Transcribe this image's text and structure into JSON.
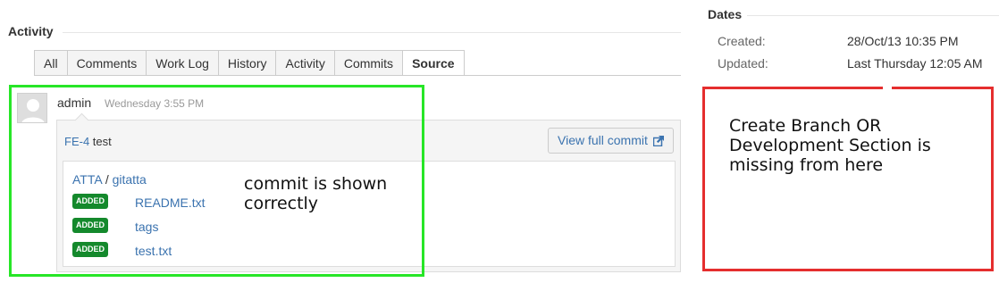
{
  "activity": {
    "title": "Activity",
    "tabs": [
      {
        "label": "All",
        "active": false
      },
      {
        "label": "Comments",
        "active": false
      },
      {
        "label": "Work Log",
        "active": false
      },
      {
        "label": "History",
        "active": false
      },
      {
        "label": "Activity",
        "active": false
      },
      {
        "label": "Commits",
        "active": false
      },
      {
        "label": "Source",
        "active": true
      }
    ]
  },
  "entry": {
    "author": "admin",
    "timestamp": "Wednesday 3:55 PM",
    "issue_key": "FE-4",
    "message": "test",
    "view_full_commit": "View full commit",
    "repo": {
      "project": "ATTA",
      "separator": "/",
      "name": "gitatta"
    },
    "files": [
      {
        "status": "ADDED",
        "name": "README.txt"
      },
      {
        "status": "ADDED",
        "name": "tags"
      },
      {
        "status": "ADDED",
        "name": "test.txt"
      }
    ]
  },
  "annotations": {
    "green_note": "commit is shown correctly",
    "green_color": "#27e627",
    "red_note": "Create Branch OR Development Section is missing from here",
    "red_color": "#e52e2e"
  },
  "dates": {
    "title": "Dates",
    "created_label": "Created:",
    "created_value": "28/Oct/13 10:35 PM",
    "updated_label": "Updated:",
    "updated_value": "Last Thursday 12:05 AM"
  },
  "colors": {
    "link": "#3b73af",
    "badge_added": "#14892c"
  }
}
